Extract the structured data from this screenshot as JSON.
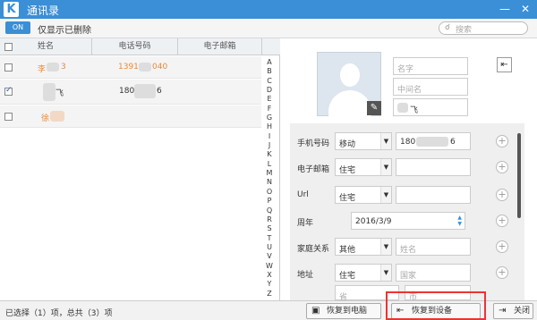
{
  "window": {
    "title": "通讯录",
    "logo": "K",
    "minimize": "—",
    "close": "✕"
  },
  "toolbar": {
    "toggle_label": "ON",
    "filter_label": "仅显示已删除",
    "search_placeholder": "搜索",
    "search_icon": "search-icon"
  },
  "table": {
    "headers": [
      "姓名",
      "电话号码",
      "电子邮箱"
    ],
    "rows": [
      {
        "checked": false,
        "name": "李",
        "name_tail": "3",
        "phone": "1391",
        "phone_tail": "040",
        "email": ""
      },
      {
        "checked": true,
        "name": "",
        "name_tail": "飞",
        "phone": "180",
        "phone_tail": "6",
        "email": ""
      },
      {
        "checked": false,
        "name": "徐",
        "name_tail": "",
        "phone": "",
        "phone_tail": "",
        "email": ""
      }
    ],
    "alphabet": [
      "A",
      "B",
      "C",
      "D",
      "E",
      "F",
      "G",
      "H",
      "I",
      "J",
      "K",
      "L",
      "M",
      "N",
      "O",
      "P",
      "Q",
      "R",
      "S",
      "T",
      "U",
      "V",
      "W",
      "X",
      "Y",
      "Z"
    ]
  },
  "status": {
    "summary": "已选择（1）项，总共（3）项",
    "restore_pc": "恢复到电脑",
    "restore_device": "恢复到设备",
    "close": "关闭"
  },
  "editor": {
    "first_name_ph": "名字",
    "middle_name_ph": "中间名",
    "last_name": "飞",
    "edit_icon": "pencil-icon",
    "phone": {
      "label": "手机号码",
      "type": "移动",
      "value_head": "180",
      "value_tail": "6"
    },
    "email": {
      "label": "电子邮箱",
      "type": "住宅",
      "value": ""
    },
    "url": {
      "label": "Url",
      "type": "住宅",
      "value": ""
    },
    "anniversary": {
      "label": "周年",
      "value": "2016/3/9"
    },
    "relation": {
      "label": "家庭关系",
      "type": "其他",
      "name_ph": "姓名"
    },
    "address": {
      "label": "地址",
      "type": "住宅",
      "country_ph": "国家",
      "province_ph": "省",
      "city_ph": "市"
    },
    "plus": "+"
  }
}
